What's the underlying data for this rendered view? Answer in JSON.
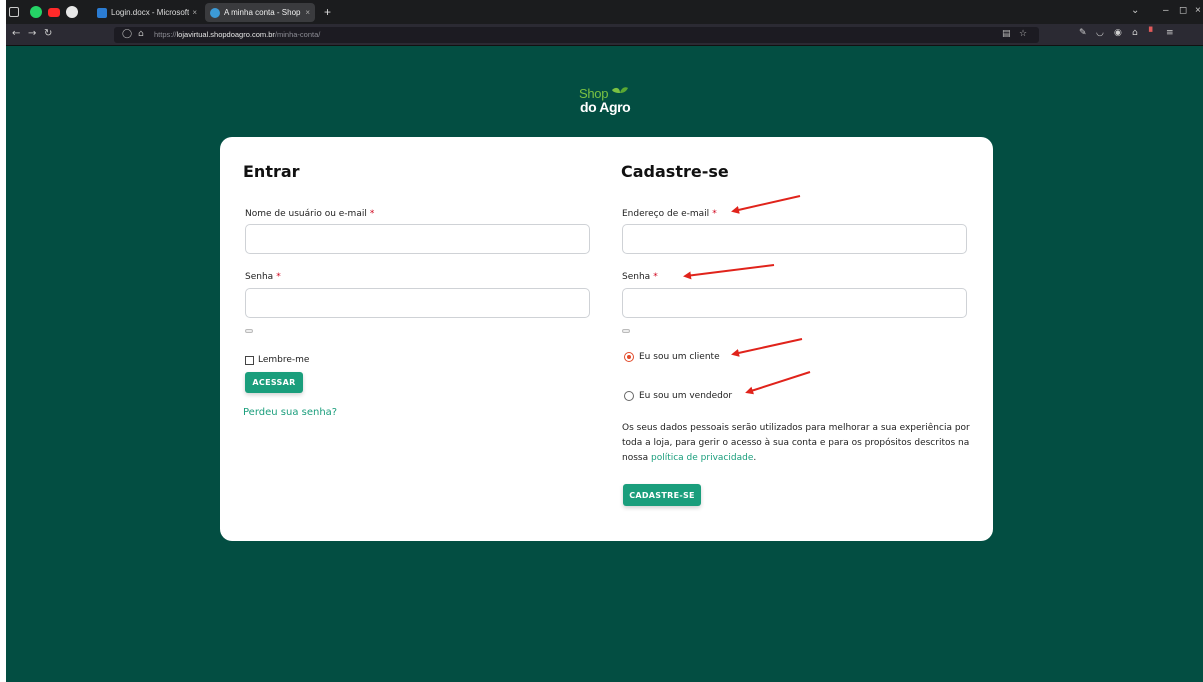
{
  "browser": {
    "tabs": [
      {
        "title": "Login.docx - Microsoft W",
        "close": "×",
        "active": false
      },
      {
        "title": "A minha conta - Shop do",
        "close": "×",
        "active": true
      }
    ],
    "new_tab": "+",
    "url": {
      "prefix": "https://",
      "host": "lojavirtual.shopdoagro.com.br",
      "path": "/minha-conta/"
    }
  },
  "page": {
    "logo": {
      "line1": "Shop",
      "line2": "do Agro"
    },
    "login": {
      "title": "Entrar",
      "username_label": "Nome de usuário ou e-mail",
      "password_label": "Senha",
      "required_mark": "*",
      "remember_label": "Lembre-me",
      "submit_label": "ACESSAR",
      "lost_password": "Perdeu sua senha?"
    },
    "register": {
      "title": "Cadastre-se",
      "email_label": "Endereço de e-mail",
      "password_label": "Senha",
      "required_mark": "*",
      "role_client": "Eu sou um cliente",
      "role_vendor": "Eu sou um vendedor",
      "privacy_text": "Os seus dados pessoais serão utilizados para melhorar a sua experiência por toda a loja, para gerir o acesso à sua conta e para os propósitos descritos na nossa",
      "privacy_link": "política de privacidade",
      "privacy_end": ".",
      "submit_label": "CADASTRE-SE"
    }
  },
  "colors": {
    "page_bg": "#034e42",
    "card_bg": "#ffffff",
    "accent": "#1a9e7c",
    "logo_green": "#7ac142",
    "required": "#d0021b",
    "annotation_arrow": "#e0231b"
  }
}
